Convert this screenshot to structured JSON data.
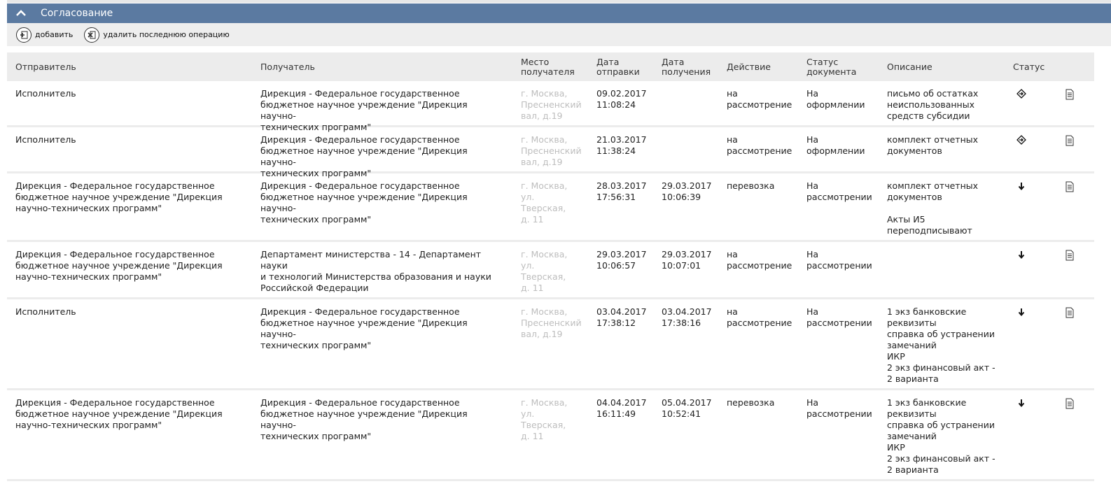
{
  "panel": {
    "title": "Согласование"
  },
  "toolbar": {
    "add_label": "добавить",
    "delete_label": "удалить последнюю операцию"
  },
  "columns": {
    "sender": "Отправитель",
    "recipient": "Получатель",
    "place": "Место\nполучателя",
    "sent": "Дата\nотправки",
    "received": "Дата\nполучения",
    "action": "Действие",
    "doc_status": "Статус\nдокумента",
    "description": "Описание",
    "status": "Статус"
  },
  "rows": [
    {
      "sender": "Исполнитель",
      "recipient": "Дирекция - Федеральное государственное\nбюджетное научное учреждение \"Дирекция научно-\nтехнических программ\"",
      "place": "г. Москва,\nПресненский\nвал, д.19",
      "sent": "09.02.2017\n11:08:24",
      "received": "",
      "action": "на\nрассмотрение",
      "doc_status": "На\nоформлении",
      "description": "письмо об остатках\nнеиспользованных\nсредств субсидии",
      "status_icon": "diamond-arrow-icon"
    },
    {
      "sender": "Исполнитель",
      "recipient": "Дирекция - Федеральное государственное\nбюджетное научное учреждение \"Дирекция научно-\nтехнических программ\"",
      "place": "г. Москва,\nПресненский\nвал, д.19",
      "sent": "21.03.2017\n11:38:24",
      "received": "",
      "action": "на\nрассмотрение",
      "doc_status": "На\nоформлении",
      "description": "комплект отчетных\nдокументов",
      "status_icon": "diamond-arrow-icon"
    },
    {
      "sender": "Дирекция - Федеральное государственное\nбюджетное научное учреждение \"Дирекция\nнаучно-технических программ\"",
      "recipient": "Дирекция - Федеральное государственное\nбюджетное научное учреждение \"Дирекция научно-\nтехнических программ\"",
      "place": "г. Москва,\nул.\nТверская,\nд. 11",
      "sent": "28.03.2017\n17:56:31",
      "received": "29.03.2017\n10:06:39",
      "action": "перевозка",
      "doc_status": "На\nрассмотрении",
      "description": "комплект отчетных\nдокументов\n\nАкты И5\nпереподписывают",
      "status_icon": "down-arrow-icon"
    },
    {
      "sender": "Дирекция - Федеральное государственное\nбюджетное научное учреждение \"Дирекция\nнаучно-технических программ\"",
      "recipient": "Департамент министерства - 14 - Департамент науки\nи технологий Министерства образования и науки\nРоссийской Федерации",
      "place": "г. Москва,\nул.\nТверская,\nд. 11",
      "sent": "29.03.2017\n10:06:57",
      "received": "29.03.2017\n10:07:01",
      "action": "на\nрассмотрение",
      "doc_status": "На\nрассмотрении",
      "description": "",
      "status_icon": "down-arrow-icon"
    },
    {
      "sender": "Исполнитель",
      "recipient": "Дирекция - Федеральное государственное\nбюджетное научное учреждение \"Дирекция научно-\nтехнических программ\"",
      "place": "г. Москва,\nПресненский\nвал, д.19",
      "sent": "03.04.2017\n17:38:12",
      "received": "03.04.2017\n17:38:16",
      "action": "на\nрассмотрение",
      "doc_status": "На\nрассмотрении",
      "description": "1 экз банковские\nреквизиты\nсправка об устранении\nзамечаний\nИКР\n2 экз финансовый акт -\n2 варианта",
      "status_icon": "down-arrow-icon"
    },
    {
      "sender": "Дирекция - Федеральное государственное\nбюджетное научное учреждение \"Дирекция\nнаучно-технических программ\"",
      "recipient": "Дирекция - Федеральное государственное\nбюджетное научное учреждение \"Дирекция научно-\nтехнических программ\"",
      "place": "г. Москва,\nул.\nТверская,\nд. 11",
      "sent": "04.04.2017\n16:11:49",
      "received": "05.04.2017\n10:52:41",
      "action": "перевозка",
      "doc_status": "На\nрассмотрении",
      "description": "1 экз банковские\nреквизиты\nсправка об устранении\nзамечаний\nИКР\n2 экз финансовый акт -\n2 варианта",
      "status_icon": "down-arrow-icon"
    }
  ]
}
